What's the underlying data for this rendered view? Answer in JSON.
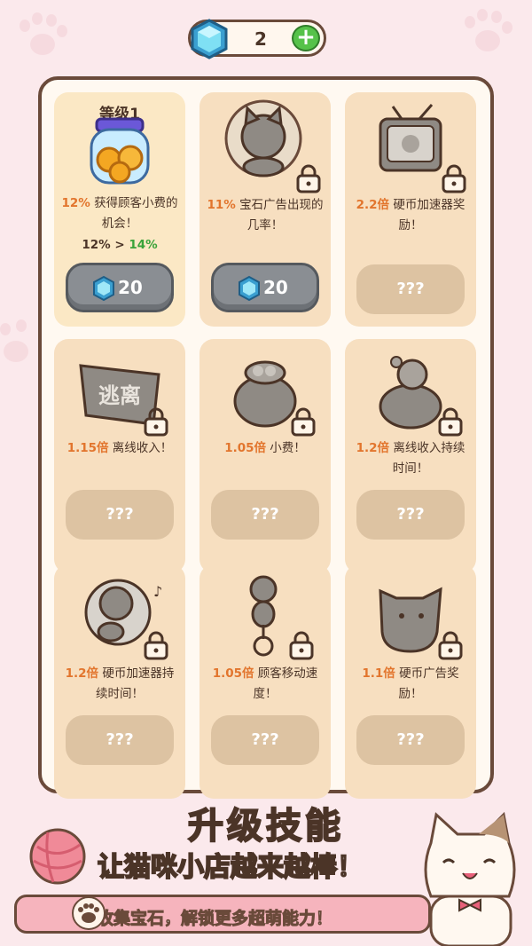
{
  "currency": {
    "gems": "2"
  },
  "cards": [
    {
      "id": "tip-jar",
      "level": "等级1",
      "value": "12%",
      "desc": "获得顾客小费的机会！",
      "progress_from": "12%",
      "progress_sep": ">",
      "progress_to": "14%",
      "button": "20",
      "locked": false
    },
    {
      "id": "gem-ad",
      "value": "11%",
      "desc": "宝石广告出现的几率！",
      "button": "20",
      "locked": true
    },
    {
      "id": "coin-boost-reward",
      "value": "2.2倍",
      "desc": "硬币加速器奖励！",
      "button": "???",
      "locked": true
    },
    {
      "id": "offline-income",
      "art_label": "逃离",
      "value": "1.15倍",
      "desc": "离线收入！",
      "button": "???",
      "locked": true
    },
    {
      "id": "tips",
      "value": "1.05倍",
      "desc": "小费！",
      "button": "???",
      "locked": true
    },
    {
      "id": "offline-duration",
      "value": "1.2倍",
      "desc": "离线收入持续时间！",
      "button": "???",
      "locked": true
    },
    {
      "id": "coin-boost-duration",
      "value": "1.2倍",
      "desc": "硬币加速器持续时间！",
      "button": "???",
      "locked": true
    },
    {
      "id": "customer-speed",
      "value": "1.05倍",
      "desc": "顾客移动速度！",
      "button": "???",
      "locked": true
    },
    {
      "id": "coin-ad-reward",
      "value": "1.1倍",
      "desc": "硬币广告奖励！",
      "button": "???",
      "locked": true
    }
  ],
  "promo": {
    "title": "升级技能",
    "subtitle": "让猫咪小店越来越棒！",
    "ribbon": "收集宝石，解锁更多超萌能力！"
  }
}
